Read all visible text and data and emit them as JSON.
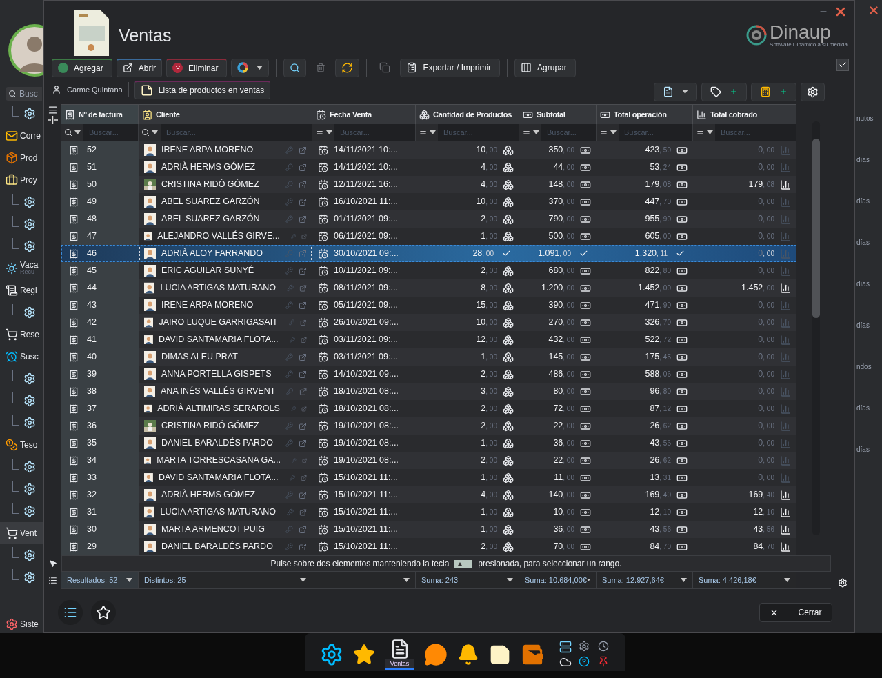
{
  "background_app": {
    "search_placeholder": "Busc",
    "sidebar_items": [
      {
        "kind": "sub"
      },
      {
        "kind": "item",
        "label": "Corre",
        "selected": false
      },
      {
        "kind": "item",
        "label": "Prod",
        "selected": false
      },
      {
        "kind": "item",
        "label": "Proy",
        "selected": false
      },
      {
        "kind": "sub"
      },
      {
        "kind": "sub"
      },
      {
        "kind": "sub"
      },
      {
        "kind": "item",
        "label": "Vaca",
        "sublabel": "Recu",
        "selected": false
      },
      {
        "kind": "item",
        "label": "Regi",
        "selected": false
      },
      {
        "kind": "sub"
      },
      {
        "kind": "item",
        "label": "Rese",
        "selected": false
      },
      {
        "kind": "item",
        "label": "Susc",
        "selected": false
      },
      {
        "kind": "sub"
      },
      {
        "kind": "sub"
      },
      {
        "kind": "sub"
      },
      {
        "kind": "item",
        "label": "Teso",
        "selected": false
      },
      {
        "kind": "sub"
      },
      {
        "kind": "sub"
      },
      {
        "kind": "sub"
      },
      {
        "kind": "item",
        "label": "Vent",
        "selected": true
      },
      {
        "kind": "sub"
      },
      {
        "kind": "sub"
      }
    ],
    "bottom_item": "Siste",
    "right_texts": [
      "nutos",
      "días",
      "días",
      "días",
      "días",
      "días",
      "ndos",
      "días",
      "días"
    ]
  },
  "window": {
    "title": "Ventas",
    "logo": "Dinaup",
    "logo_tagline": "Software Dinámico a su medida"
  },
  "toolbar": [
    {
      "kind": "add",
      "label": "Agregar"
    },
    {
      "kind": "open",
      "label": "Abrir"
    },
    {
      "kind": "delete",
      "label": "Eliminar"
    },
    {
      "kind": "color"
    },
    {
      "kind": "sep"
    },
    {
      "kind": "search"
    },
    {
      "kind": "trash",
      "disabled": true
    },
    {
      "kind": "refresh"
    },
    {
      "kind": "sep"
    },
    {
      "kind": "copy",
      "disabled": true
    },
    {
      "kind": "export",
      "label": "Exportar / Imprimir"
    },
    {
      "kind": "sep"
    },
    {
      "kind": "group",
      "label": "Agrupar"
    }
  ],
  "user": "Carme Quintana",
  "report_button": "Lista de productos en ventas",
  "show_checkbox": {
    "checked": true
  },
  "columns": [
    {
      "kind": "invoice",
      "label": "Nº de factura",
      "placeholder": "Buscar..."
    },
    {
      "kind": "client",
      "label": "Cliente",
      "placeholder": "Buscar..."
    },
    {
      "kind": "date",
      "label": "Fecha Venta",
      "placeholder": "Buscar..."
    },
    {
      "kind": "qty",
      "label": "Cantidad de Productos",
      "placeholder": "Buscar..."
    },
    {
      "kind": "subtotal",
      "label": "Subtotal",
      "placeholder": "Buscar..."
    },
    {
      "kind": "total",
      "label": "Total operación",
      "placeholder": "Buscar..."
    },
    {
      "kind": "paid",
      "label": "Total cobrado",
      "placeholder": "Buscar..."
    }
  ],
  "rows": [
    {
      "n": "52",
      "client": "IRENE ARPA MORENO",
      "photo": false,
      "date": "14/11/2021 10:...",
      "qty": [
        "10",
        ", 00"
      ],
      "sub": [
        "350",
        ", 00"
      ],
      "total": [
        "423",
        ", 50"
      ],
      "paid": [
        "0",
        ", 00"
      ],
      "collected": false,
      "selected": false
    },
    {
      "n": "51",
      "client": "ADRIÀ HERMS GÓMEZ",
      "photo": false,
      "date": "14/11/2021 10:...",
      "qty": [
        "4",
        ", 00"
      ],
      "sub": [
        "44",
        ", 00"
      ],
      "total": [
        "53",
        ", 24"
      ],
      "paid": [
        "0",
        ", 00"
      ],
      "collected": false,
      "selected": false
    },
    {
      "n": "50",
      "client": "CRISTINA RIDÓ GÓMEZ",
      "photo": true,
      "date": "12/11/2021 16:...",
      "qty": [
        "4",
        ", 00"
      ],
      "sub": [
        "148",
        ", 00"
      ],
      "total": [
        "179",
        ", 08"
      ],
      "paid": [
        "179",
        ", 08"
      ],
      "collected": true,
      "selected": false
    },
    {
      "n": "49",
      "client": "ABEL SUAREZ GARZÓN",
      "photo": false,
      "date": "16/10/2021 11:...",
      "qty": [
        "10",
        ", 00"
      ],
      "sub": [
        "370",
        ", 00"
      ],
      "total": [
        "447",
        ", 70"
      ],
      "paid": [
        "0",
        ", 00"
      ],
      "collected": false,
      "selected": false
    },
    {
      "n": "48",
      "client": "ABEL SUAREZ GARZÓN",
      "photo": false,
      "date": "01/11/2021 09:...",
      "qty": [
        "2",
        ", 00"
      ],
      "sub": [
        "790",
        ", 00"
      ],
      "total": [
        "955",
        ", 90"
      ],
      "paid": [
        "0",
        ", 00"
      ],
      "collected": false,
      "selected": false
    },
    {
      "n": "47",
      "client": "ALEJANDRO VALLÉS GIRVE...",
      "photo": false,
      "date": "06/11/2021 09:...",
      "qty": [
        "1",
        ", 00"
      ],
      "sub": [
        "500",
        ", 00"
      ],
      "total": [
        "605",
        ", 00"
      ],
      "paid": [
        "0",
        ", 00"
      ],
      "collected": false,
      "selected": false
    },
    {
      "n": "46",
      "client": "ADRIÀ ALOY FARRANDO",
      "photo": false,
      "date": "30/10/2021 09:...",
      "qty": [
        "28",
        ", 00"
      ],
      "sub": [
        "1.091",
        ", 00"
      ],
      "total": [
        "1.320",
        ", 11"
      ],
      "paid": [
        "0",
        ", 00"
      ],
      "collected": false,
      "selected": true
    },
    {
      "n": "45",
      "client": "ERIC AGUILAR SUNYÉ",
      "photo": false,
      "date": "10/11/2021 09:...",
      "qty": [
        "2",
        ", 00"
      ],
      "sub": [
        "680",
        ", 00"
      ],
      "total": [
        "822",
        ", 80"
      ],
      "paid": [
        "0",
        ", 00"
      ],
      "collected": false,
      "selected": false
    },
    {
      "n": "44",
      "client": "LUCIA ARTIGAS MATURANO",
      "photo": false,
      "date": "08/11/2021 09:...",
      "qty": [
        "8",
        ", 00"
      ],
      "sub": [
        "1.200",
        ", 00"
      ],
      "total": [
        "1.452",
        ", 00"
      ],
      "paid": [
        "1.452",
        ", 00"
      ],
      "collected": true,
      "selected": false
    },
    {
      "n": "43",
      "client": "IRENE ARPA MORENO",
      "photo": false,
      "date": "05/11/2021 09:...",
      "qty": [
        "15",
        ", 00"
      ],
      "sub": [
        "390",
        ", 00"
      ],
      "total": [
        "471",
        ", 90"
      ],
      "paid": [
        "0",
        ", 00"
      ],
      "collected": false,
      "selected": false
    },
    {
      "n": "42",
      "client": "JAIRO LUQUE GARRIGASAIT",
      "photo": false,
      "date": "26/10/2021 09:...",
      "qty": [
        "10",
        ", 00"
      ],
      "sub": [
        "270",
        ", 00"
      ],
      "total": [
        "326",
        ", 70"
      ],
      "paid": [
        "0",
        ", 00"
      ],
      "collected": false,
      "selected": false
    },
    {
      "n": "41",
      "client": "DAVID SANTAMARIA FLOTA...",
      "photo": false,
      "date": "03/11/2021 09:...",
      "qty": [
        "12",
        ", 00"
      ],
      "sub": [
        "432",
        ", 00"
      ],
      "total": [
        "522",
        ", 72"
      ],
      "paid": [
        "0",
        ", 00"
      ],
      "collected": false,
      "selected": false
    },
    {
      "n": "40",
      "client": "DIMAS ALEU PRAT",
      "photo": false,
      "date": "03/11/2021 09:...",
      "qty": [
        "1",
        ", 00"
      ],
      "sub": [
        "145",
        ", 00"
      ],
      "total": [
        "175",
        ", 45"
      ],
      "paid": [
        "0",
        ", 00"
      ],
      "collected": false,
      "selected": false
    },
    {
      "n": "39",
      "client": "ANNA PORTELLA GISPETS",
      "photo": false,
      "date": "14/10/2021 09:...",
      "qty": [
        "2",
        ", 00"
      ],
      "sub": [
        "486",
        ", 00"
      ],
      "total": [
        "588",
        ", 06"
      ],
      "paid": [
        "0",
        ", 00"
      ],
      "collected": false,
      "selected": false
    },
    {
      "n": "38",
      "client": "ANA INÉS VALLÉS GIRVENT",
      "photo": false,
      "date": "18/10/2021 08:...",
      "qty": [
        "3",
        ", 00"
      ],
      "sub": [
        "80",
        ", 00"
      ],
      "total": [
        "96",
        ", 80"
      ],
      "paid": [
        "0",
        ", 00"
      ],
      "collected": false,
      "selected": false
    },
    {
      "n": "37",
      "client": "ADRIÀ ALTIMIRAS SERAROLS",
      "photo": false,
      "date": "18/10/2021 08:...",
      "qty": [
        "2",
        ", 00"
      ],
      "sub": [
        "72",
        ", 00"
      ],
      "total": [
        "87",
        ", 12"
      ],
      "paid": [
        "0",
        ", 00"
      ],
      "collected": false,
      "selected": false
    },
    {
      "n": "36",
      "client": "CRISTINA RIDÓ GÓMEZ",
      "photo": true,
      "date": "19/10/2021 08:...",
      "qty": [
        "2",
        ", 00"
      ],
      "sub": [
        "22",
        ", 00"
      ],
      "total": [
        "26",
        ", 62"
      ],
      "paid": [
        "0",
        ", 00"
      ],
      "collected": false,
      "selected": false
    },
    {
      "n": "35",
      "client": "DANIEL BARALDÉS PARDO",
      "photo": false,
      "date": "19/10/2021 08:...",
      "qty": [
        "1",
        ", 00"
      ],
      "sub": [
        "36",
        ", 00"
      ],
      "total": [
        "43",
        ", 56"
      ],
      "paid": [
        "0",
        ", 00"
      ],
      "collected": false,
      "selected": false
    },
    {
      "n": "34",
      "client": "MARTA TORRESCASANA GA...",
      "photo": false,
      "date": "19/10/2021 08:...",
      "qty": [
        "2",
        ", 00"
      ],
      "sub": [
        "22",
        ", 00"
      ],
      "total": [
        "26",
        ", 62"
      ],
      "paid": [
        "0",
        ", 00"
      ],
      "collected": false,
      "selected": false
    },
    {
      "n": "33",
      "client": "DAVID SANTAMARIA FLOTA...",
      "photo": false,
      "date": "15/10/2021 11:...",
      "qty": [
        "1",
        ", 00"
      ],
      "sub": [
        "11",
        ", 00"
      ],
      "total": [
        "13",
        ", 31"
      ],
      "paid": [
        "0",
        ", 00"
      ],
      "collected": false,
      "selected": false
    },
    {
      "n": "32",
      "client": "ADRIÀ HERMS GÓMEZ",
      "photo": false,
      "date": "15/10/2021 11:...",
      "qty": [
        "4",
        ", 00"
      ],
      "sub": [
        "140",
        ", 00"
      ],
      "total": [
        "169",
        ", 40"
      ],
      "paid": [
        "169",
        ", 40"
      ],
      "collected": true,
      "selected": false
    },
    {
      "n": "31",
      "client": "LUCIA ARTIGAS MATURANO",
      "photo": false,
      "date": "15/10/2021 11:...",
      "qty": [
        "1",
        ", 00"
      ],
      "sub": [
        "10",
        ", 00"
      ],
      "total": [
        "12",
        ", 10"
      ],
      "paid": [
        "12",
        ", 10"
      ],
      "collected": true,
      "selected": false
    },
    {
      "n": "30",
      "client": "MARTA ARMENCOT PUIG",
      "photo": false,
      "date": "15/10/2021 11:...",
      "qty": [
        "1",
        ", 00"
      ],
      "sub": [
        "36",
        ", 00"
      ],
      "total": [
        "43",
        ", 56"
      ],
      "paid": [
        "43",
        ", 56"
      ],
      "collected": true,
      "selected": false
    },
    {
      "n": "29",
      "client": "DANIEL BARALDÉS PARDO",
      "photo": false,
      "date": "15/10/2021 11:...",
      "qty": [
        "2",
        ", 00"
      ],
      "sub": [
        "70",
        ", 00"
      ],
      "total": [
        "84",
        ", 70"
      ],
      "paid": [
        "84",
        ", 70"
      ],
      "collected": true,
      "selected": false
    }
  ],
  "hint": {
    "before": "Pulse sobre dos elementos manteniendo la tecla",
    "after": "presionada, para seleccionar un rango."
  },
  "footer": [
    {
      "text": "Resultados: 52",
      "selected": true
    },
    {
      "text": "Distintos: 25",
      "selected": false
    },
    {
      "selected": false
    },
    {
      "text": "Suma: 243",
      "selected": false
    },
    {
      "text": "Suma: 10.684,00€",
      "selected": false
    },
    {
      "text": "Suma: 12.927,64€",
      "selected": false
    },
    {
      "text": "Suma: 4.426,18€",
      "selected": false
    }
  ],
  "close_button": "Cerrar",
  "taskbar": {
    "active_label": "Ventas"
  }
}
